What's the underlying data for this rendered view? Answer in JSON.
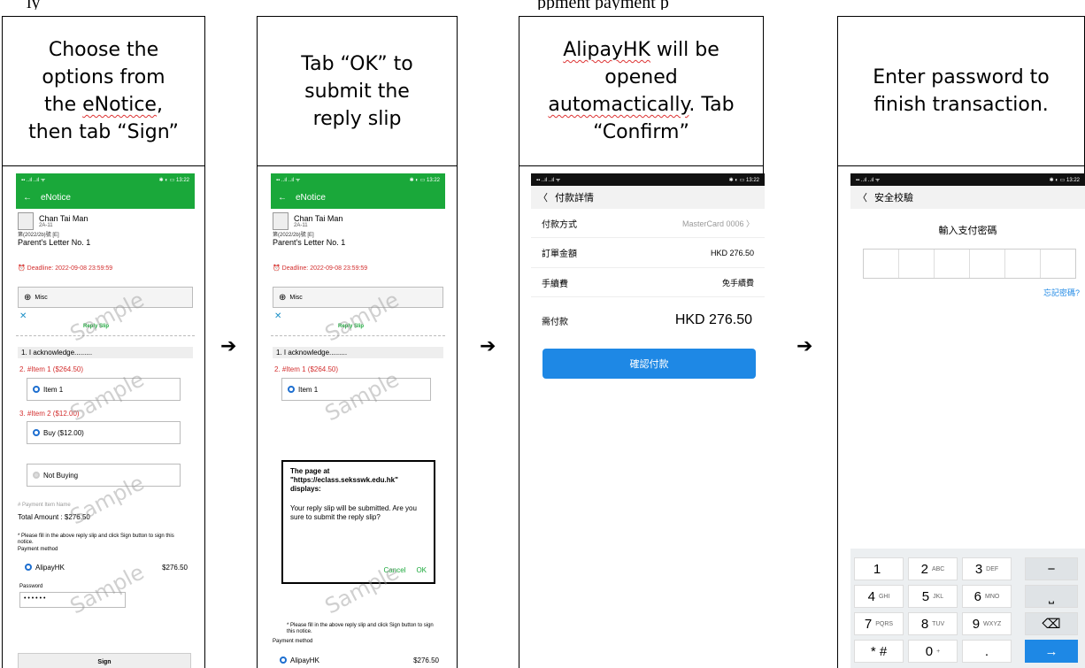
{
  "top_text": {
    "left": "ly",
    "right": "ppment payment p"
  },
  "steps": [
    {
      "caption_lines": [
        "Choose the",
        "options from",
        "the eNotice,",
        "then tab “Sign”"
      ]
    },
    {
      "caption_lines": [
        "Tab “OK” to",
        "submit the",
        "reply slip"
      ]
    },
    {
      "caption_lines": [
        "AlipayHK will be",
        "opened",
        "automactically. Tab",
        "“Confirm”"
      ]
    },
    {
      "caption_lines": [
        "Enter password to",
        "finish transaction."
      ]
    }
  ],
  "arrow_glyph": "➔",
  "enotice": {
    "status_left": "▪▪ ..ıl ..ıl ᯤ",
    "status_right": "✱ ◐ ▭ 13:22",
    "back_glyph": "←",
    "title": "eNotice",
    "student_name": "Chan Tai Man",
    "student_class": "2A-11",
    "notice_code": "第(2022/2b)號 [E]",
    "letter_title": "Parent's Letter No. 1",
    "deadline": "Deadline: 2022-09-08 23:59:59",
    "misc_label": "Misc",
    "reply_slip_label": "Reply Slip",
    "q1": "1. I acknowledge.........",
    "q2": "2. #Item 1 ($264.50)",
    "q2_option": "Item 1",
    "q3": "3. #Item 2 ($12.00)",
    "q3_option_a": "Buy ($12.00)",
    "q3_option_b": "Not Buying",
    "payment_item_name": "# Payment Item Name",
    "total_amount": "Total Amount : $276.50",
    "fill_note": "* Please fill in the above reply slip and click Sign button to sign this notice.",
    "payment_method_label": "Payment method",
    "payment_option": "AlipayHK",
    "payment_amount": "$276.50",
    "password_label": "Password",
    "password_dots": "• • • • • •",
    "sign_button": "Sign",
    "watermark": "Sample"
  },
  "dialog": {
    "title": "The page at \"https://eclass.seksswk.edu.hk\" displays:",
    "message": "Your reply slip will be submitted. Are you sure to submit the reply slip?",
    "cancel": "Cancel",
    "ok": "OK"
  },
  "alipay_payment": {
    "status_left": "▪▪ ..ıl ..ıl ᯤ",
    "status_right": "✱ ◐ ▭ 13:22",
    "back_glyph": "〈",
    "title": "付款詳情",
    "rows": [
      {
        "label": "付款方式",
        "value": "MasterCard 0006 〉"
      },
      {
        "label": "訂單金額",
        "value": "HKD 276.50"
      },
      {
        "label": "手續費",
        "value": "免手續費"
      }
    ],
    "due_label": "需付款",
    "due_value": "HKD 276.50",
    "confirm_button": "確認付款"
  },
  "alipay_password": {
    "status_left": "▪▪ ..ıl ..ıl ᯤ",
    "status_right": "✱ ◐ ▭ 13:22",
    "back_glyph": "〈",
    "title": "安全校驗",
    "prompt": "輸入支付密碼",
    "forgot": "忘記密碼?",
    "keys": [
      {
        "main": "1",
        "sub": ""
      },
      {
        "main": "2",
        "sub": "ABC"
      },
      {
        "main": "3",
        "sub": "DEF"
      },
      {
        "main": "−",
        "sub": ""
      },
      {
        "main": "4",
        "sub": "GHI"
      },
      {
        "main": "5",
        "sub": "JKL"
      },
      {
        "main": "6",
        "sub": "MNO"
      },
      {
        "main": "⎵",
        "sub": ""
      },
      {
        "main": "7",
        "sub": "PQRS"
      },
      {
        "main": "8",
        "sub": "TUV"
      },
      {
        "main": "9",
        "sub": "WXYZ"
      },
      {
        "main": "⌫",
        "sub": ""
      },
      {
        "main": "* #",
        "sub": ""
      },
      {
        "main": "0",
        "sub": "+"
      },
      {
        "main": ".",
        "sub": ""
      },
      {
        "main": "→",
        "sub": ""
      }
    ]
  },
  "colors": {
    "green": "#1aa83a",
    "blue": "#1e88e5",
    "red": "#d32f2f"
  }
}
